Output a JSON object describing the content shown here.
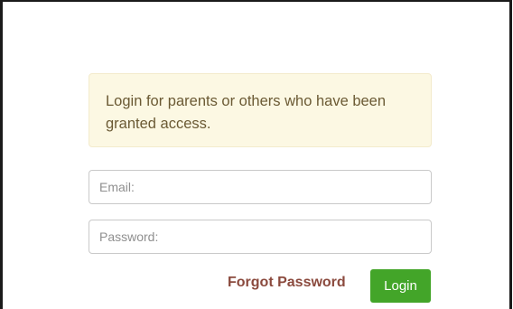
{
  "notice": {
    "text": "Login for parents or others who have been granted access."
  },
  "form": {
    "email_placeholder": "Email:",
    "password_placeholder": "Password:",
    "forgot_label": "Forgot Password",
    "login_label": "Login"
  },
  "colors": {
    "notice_background": "#fcf8e3",
    "notice_text": "#6b5a34",
    "link": "#8b4a3e",
    "button_background": "#43a529",
    "button_text": "#ffffff"
  }
}
